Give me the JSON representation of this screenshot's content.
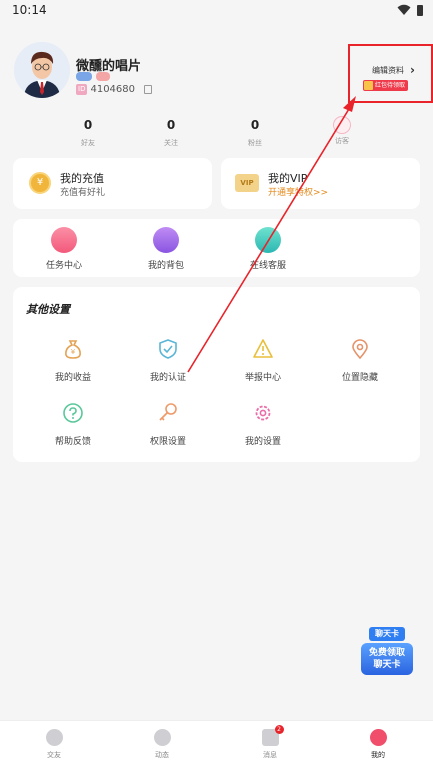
{
  "status_bar": {
    "time": "10:14"
  },
  "profile": {
    "name": "微醺的唱片",
    "id_tag": "ID",
    "user_id": "4104680",
    "edit_label": "编辑资料",
    "redpacket_label": "红包待领取"
  },
  "stats": [
    {
      "value": "0",
      "label": "好友"
    },
    {
      "value": "0",
      "label": "关注"
    },
    {
      "value": "0",
      "label": "粉丝"
    },
    {
      "value": "",
      "label": "访客"
    }
  ],
  "recharge": {
    "title": "我的充值",
    "subtitle": "充值有好礼"
  },
  "vip": {
    "title": "我的VIP",
    "subtitle": "开通享特权>>",
    "icon_text": "VIP"
  },
  "services": [
    {
      "label": "任务中心",
      "icon": "task-center-icon"
    },
    {
      "label": "我的背包",
      "icon": "backpack-icon"
    },
    {
      "label": "在线客服",
      "icon": "customer-service-icon"
    }
  ],
  "settings": {
    "title": "其他设置",
    "items": [
      {
        "label": "我的收益",
        "icon": "money-bag-icon",
        "color": "#e4a254"
      },
      {
        "label": "我的认证",
        "icon": "shield-check-icon",
        "color": "#5ab6d6"
      },
      {
        "label": "举报中心",
        "icon": "warning-icon",
        "color": "#e8bf3a"
      },
      {
        "label": "位置隐藏",
        "icon": "location-pin-icon",
        "color": "#e5936a"
      },
      {
        "label": "帮助反馈",
        "icon": "help-icon",
        "color": "#5ac79a"
      },
      {
        "label": "权限设置",
        "icon": "key-icon",
        "color": "#ef9a6a"
      },
      {
        "label": "我的设置",
        "icon": "gear-icon",
        "color": "#ea6ca8"
      }
    ]
  },
  "promo": {
    "top": "聊天卡",
    "line1": "免费领取",
    "line2": "聊天卡"
  },
  "tabs": [
    {
      "label": "交友",
      "icon": "heart-icon",
      "active": false
    },
    {
      "label": "动态",
      "icon": "compass-icon",
      "active": false
    },
    {
      "label": "消息",
      "icon": "message-icon",
      "active": false,
      "badge": "2"
    },
    {
      "label": "我的",
      "icon": "profile-icon",
      "active": true
    }
  ],
  "colors": {
    "accent": "#f04e6a",
    "annotation_red": "#e8232a",
    "vip_text": "#e38a1c"
  }
}
